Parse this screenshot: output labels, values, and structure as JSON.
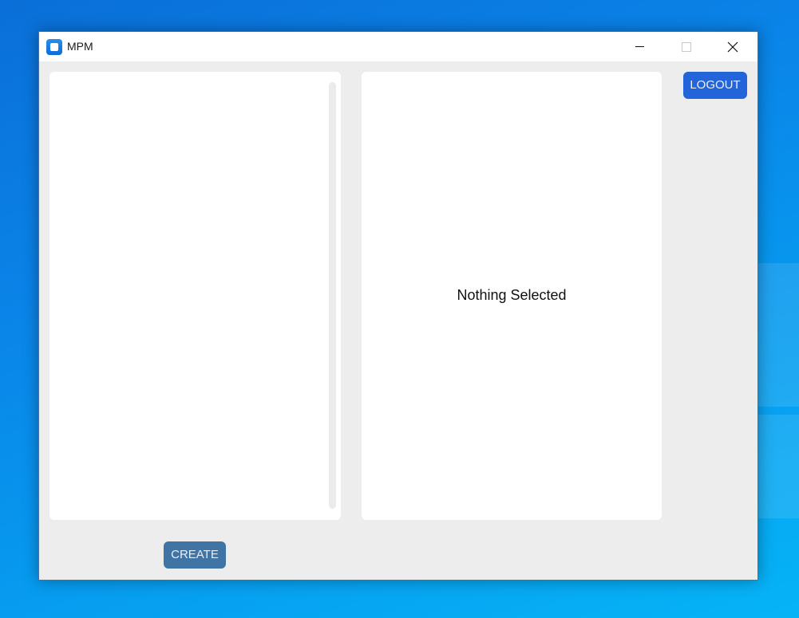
{
  "window": {
    "title": "MPM",
    "controls": {
      "minimize_icon": "minimize-icon",
      "maximize_icon": "maximize-icon",
      "close_icon": "close-icon"
    }
  },
  "header": {
    "logout_label": "LOGOUT"
  },
  "detail": {
    "empty_text": "Nothing Selected"
  },
  "footer": {
    "create_label": "CREATE"
  },
  "colors": {
    "logout_button": "#2364d8",
    "create_button": "#3f74a4",
    "window_background": "#ededed",
    "panel_background": "#ffffff"
  }
}
